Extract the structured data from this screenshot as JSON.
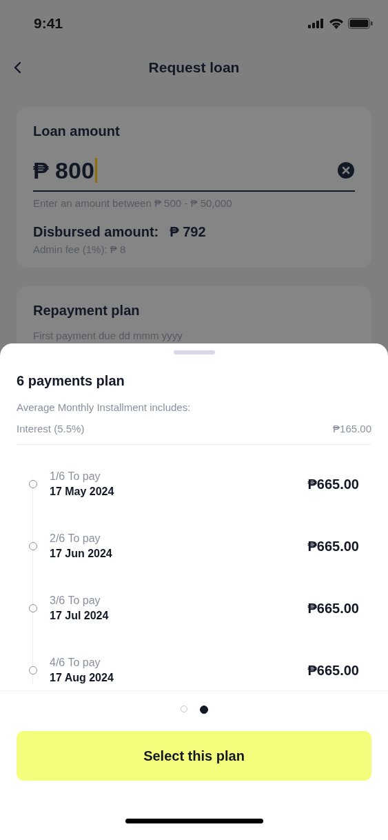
{
  "status_bar": {
    "time": "9:41"
  },
  "header": {
    "title": "Request loan"
  },
  "loan_card": {
    "title": "Loan amount",
    "currency": "₱",
    "amount": "800",
    "hint": "Enter an amount between ₱ 500 - ₱ 50,000",
    "disbursed_label": "Disbursed amount:",
    "disbursed_value": "₱ 792",
    "fee": "Admin fee (1%):  ₱ 8"
  },
  "repayment_card": {
    "title": "Repayment plan",
    "subtitle": "First payment due dd mmm yyyy"
  },
  "sheet": {
    "title": "6 payments plan",
    "subtitle": "Average Monthly Installment includes:",
    "interest_label": "Interest (5.5%)",
    "interest_value": "₱165.00",
    "payments": [
      {
        "label": "1/6 To pay",
        "date": "17 May 2024",
        "amount": "₱665.00"
      },
      {
        "label": "2/6 To pay",
        "date": "17 Jun 2024",
        "amount": "₱665.00"
      },
      {
        "label": "3/6 To pay",
        "date": "17 Jul 2024",
        "amount": "₱665.00"
      },
      {
        "label": "4/6 To pay",
        "date": "17 Aug 2024",
        "amount": "₱665.00"
      }
    ],
    "pages": [
      {
        "selected": false
      },
      {
        "selected": true
      }
    ],
    "button": "Select this plan"
  }
}
